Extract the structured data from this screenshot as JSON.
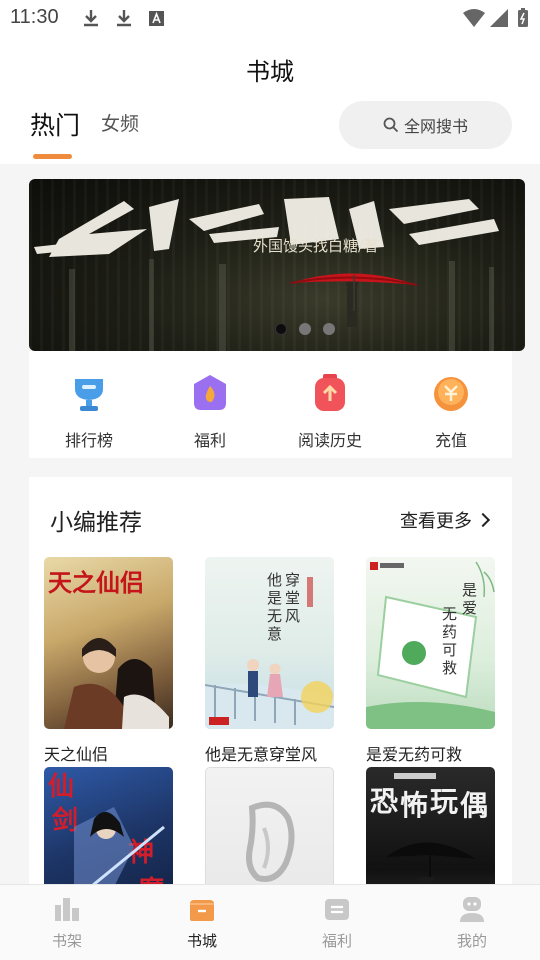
{
  "status_bar": {
    "time": "11:30"
  },
  "header": {
    "title": "书城",
    "tabs": [
      {
        "label": "热门",
        "active": true
      },
      {
        "label": "女频",
        "active": false
      }
    ],
    "search_placeholder": "全网搜书"
  },
  "banner": {
    "subtitle": "外国馒头找白糖/著",
    "slide_count": 3,
    "active_slide": 1
  },
  "quick_actions": [
    {
      "label": "排行榜",
      "icon": "trophy-icon",
      "color": "#4a9ee8"
    },
    {
      "label": "福利",
      "icon": "gift-flame-icon",
      "color": "#9a6ff0"
    },
    {
      "label": "阅读历史",
      "icon": "history-icon",
      "color": "#f0545a"
    },
    {
      "label": "充值",
      "icon": "coin-icon",
      "color": "#f5923c"
    }
  ],
  "recommend": {
    "title": "小编推荐",
    "more_label": "查看更多",
    "books": [
      {
        "title": "天之仙侣"
      },
      {
        "title": "他是无意穿堂风"
      },
      {
        "title": "是爱无药可救"
      },
      {
        "title": ""
      },
      {
        "title": ""
      },
      {
        "title": ""
      }
    ]
  },
  "bottom_nav": [
    {
      "label": "书架",
      "icon": "bookshelf-icon",
      "active": false
    },
    {
      "label": "书城",
      "icon": "bookstore-icon",
      "active": true
    },
    {
      "label": "福利",
      "icon": "welfare-icon",
      "active": false
    },
    {
      "label": "我的",
      "icon": "profile-icon",
      "active": false
    }
  ],
  "colors": {
    "accent": "#f08a3c",
    "active_nav": "#f29a4a",
    "inactive_nav": "#c8c8c8"
  }
}
